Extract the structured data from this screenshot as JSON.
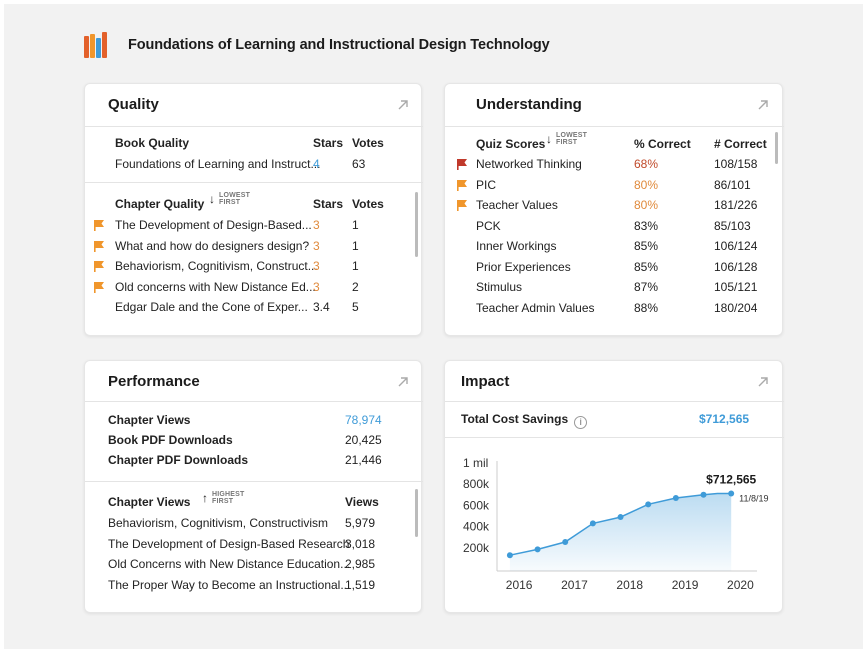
{
  "header": {
    "title": "Foundations of Learning and Instructional Design Technology",
    "icon": "books-icon"
  },
  "quality": {
    "title": "Quality",
    "book_header": {
      "label": "Book Quality",
      "stars": "Stars",
      "votes": "Votes"
    },
    "book_row": {
      "name": "Foundations of Learning and Instruct...",
      "stars": "4",
      "votes": "63"
    },
    "chapter_header": {
      "label": "Chapter Quality",
      "sort": "LOWEST\nFIRST",
      "stars": "Stars",
      "votes": "Votes"
    },
    "chapters": [
      {
        "name": "The Development of Design-Based...",
        "stars": "3",
        "votes": "1",
        "flag": "orange"
      },
      {
        "name": "What and how do designers design?",
        "stars": "3",
        "votes": "1",
        "flag": "orange"
      },
      {
        "name": "Behaviorism, Cognitivism, Construct...",
        "stars": "3",
        "votes": "1",
        "flag": "orange"
      },
      {
        "name": "Old concerns with New Distance Ed...",
        "stars": "3",
        "votes": "2",
        "flag": "orange"
      },
      {
        "name": "Edgar Dale and the Cone of Exper...",
        "stars": "3.4",
        "votes": "5",
        "flag": ""
      }
    ]
  },
  "understanding": {
    "title": "Understanding",
    "header": {
      "label": "Quiz Scores",
      "sort_top": "LOWEST",
      "sort_bottom": "FIRST",
      "pct": "% Correct",
      "num": "# Correct"
    },
    "rows": [
      {
        "name": "Networked Thinking",
        "pct": "68%",
        "num": "108/158",
        "flag": "red"
      },
      {
        "name": "PIC",
        "pct": "80%",
        "num": "86/101",
        "flag": "orange"
      },
      {
        "name": "Teacher Values",
        "pct": "80%",
        "num": "181/226",
        "flag": "orange"
      },
      {
        "name": "PCK",
        "pct": "83%",
        "num": "85/103",
        "flag": ""
      },
      {
        "name": "Inner Workings",
        "pct": "85%",
        "num": "106/124",
        "flag": ""
      },
      {
        "name": "Prior Experiences",
        "pct": "85%",
        "num": "106/128",
        "flag": ""
      },
      {
        "name": "Stimulus",
        "pct": "87%",
        "num": "105/121",
        "flag": ""
      },
      {
        "name": "Teacher Admin Values",
        "pct": "88%",
        "num": "180/204",
        "flag": ""
      }
    ]
  },
  "performance": {
    "title": "Performance",
    "stats": [
      {
        "label": "Chapter Views",
        "value": "78,974"
      },
      {
        "label": "Book PDF Downloads",
        "value": "20,425"
      },
      {
        "label": "Chapter PDF Downloads",
        "value": "21,446"
      }
    ],
    "chapter_header": {
      "label": "Chapter Views",
      "sort_top": "HIGHEST",
      "sort_bottom": "FIRST",
      "col": "Views"
    },
    "chapters": [
      {
        "name": "Behaviorism, Cognitivism, Constructivism",
        "views": "5,979"
      },
      {
        "name": "The Development of Design-Based Research",
        "views": "3,018"
      },
      {
        "name": "Old Concerns with New Distance Education...",
        "views": "2,985"
      },
      {
        "name": "The Proper Way to Become an Instructional...",
        "views": "1,519"
      }
    ]
  },
  "impact": {
    "title": "Impact",
    "savings_label": "Total Cost Savings",
    "savings_value": "$712,565",
    "chart_data": {
      "type": "area",
      "x": [
        "2015-11",
        "2016-05",
        "2016-11",
        "2017-05",
        "2017-11",
        "2018-05",
        "2018-11",
        "2019-05",
        "2019-08",
        "2019-11"
      ],
      "values": [
        130000,
        185000,
        255000,
        430000,
        490000,
        610000,
        670000,
        700000,
        712565,
        712565
      ],
      "ytick_labels": [
        "200k",
        "400k",
        "600k",
        "800k",
        "1 mil"
      ],
      "yticks": [
        200000,
        400000,
        600000,
        800000,
        1000000
      ],
      "xtick_labels": [
        "2016",
        "2017",
        "2018",
        "2019",
        "2020"
      ],
      "ylim": [
        0,
        1000000
      ],
      "last_label": "$712,565",
      "last_date": "11/8/19",
      "color": "#3f9bd8"
    }
  },
  "colors": {
    "accent": "#3f9bd8",
    "orange_flag": "#f0962c",
    "red_flag": "#c0392b"
  }
}
